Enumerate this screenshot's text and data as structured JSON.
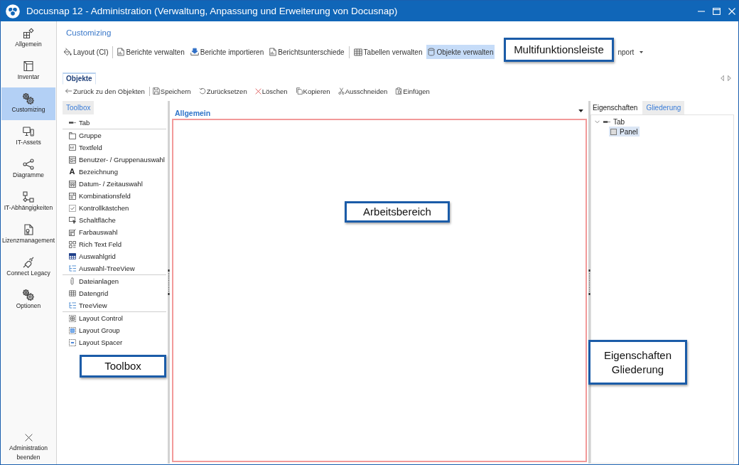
{
  "window": {
    "title": "Docusnap 12 - Administration (Verwaltung, Anpassung und Erweiterung von Docusnap)"
  },
  "sidebar": {
    "items": [
      {
        "label": "Allgemein",
        "selected": false
      },
      {
        "label": "Inventar",
        "selected": false
      },
      {
        "label": "Customizing",
        "selected": true
      },
      {
        "label": "IT-Assets",
        "selected": false
      },
      {
        "label": "Diagramme",
        "selected": false
      },
      {
        "label": "IT-Abhängigkeiten",
        "selected": false
      },
      {
        "label": "Lizenzmanagement",
        "selected": false
      },
      {
        "label": "Connect Legacy",
        "selected": false
      },
      {
        "label": "Optionen",
        "selected": false
      }
    ],
    "exit_button": {
      "label": "Administration beenden"
    }
  },
  "ribbon": {
    "tabs": [
      {
        "label": "Customizing",
        "selected": true
      }
    ],
    "groups": [
      {
        "buttons": [
          {
            "label": "Layout (CI)",
            "selected": false,
            "dropdown": false
          }
        ]
      },
      {
        "buttons": [
          {
            "label": "Berichte verwalten",
            "selected": false,
            "dropdown": false
          },
          {
            "label": "Berichte importieren",
            "selected": false,
            "dropdown": false
          },
          {
            "label": "Berichtsunterschiede",
            "selected": false,
            "dropdown": false
          }
        ]
      },
      {
        "buttons": [
          {
            "label": "Tabellen verwalten",
            "selected": false,
            "dropdown": false
          },
          {
            "label": "Objekte verwalten",
            "selected": true,
            "dropdown": false
          },
          {
            "label": "nport",
            "selected": false,
            "dropdown": true
          }
        ]
      }
    ]
  },
  "document_tabs": [
    {
      "label": "Objekte",
      "selected": true
    }
  ],
  "toolbar": {
    "groups": [
      {
        "buttons": [
          {
            "label": "Zurück zu den Objekten"
          }
        ]
      },
      {
        "buttons": [
          {
            "label": "Speichern"
          },
          {
            "label": "Zurücksetzen"
          },
          {
            "label": "Löschen"
          },
          {
            "label": "Kopieren"
          },
          {
            "label": "Ausschneiden"
          },
          {
            "label": "Einfügen"
          }
        ]
      }
    ]
  },
  "toolbox": {
    "tabs": [
      {
        "label": "Toolbox",
        "selected": true
      }
    ],
    "groups": [
      {
        "items": [
          {
            "label": "Tab"
          }
        ]
      },
      {
        "items": [
          {
            "label": "Gruppe"
          },
          {
            "label": "Textfeld"
          },
          {
            "label": "Benutzer- / Gruppenauswahl"
          },
          {
            "label": "Bezeichnung",
            "glyph": "A"
          },
          {
            "label": "Datum- / Zeitauswahl"
          },
          {
            "label": "Kombinationsfeld"
          },
          {
            "label": "Kontrollkästchen"
          },
          {
            "label": "Schaltfläche"
          },
          {
            "label": "Farbauswahl"
          },
          {
            "label": "Rich Text Feld"
          },
          {
            "label": "Auswahlgrid"
          },
          {
            "label": "Auswahl-TreeView"
          }
        ]
      },
      {
        "items": [
          {
            "label": "Dateianlagen"
          },
          {
            "label": "Datengrid"
          },
          {
            "label": "TreeView"
          }
        ]
      },
      {
        "items": [
          {
            "label": "Layout Control"
          },
          {
            "label": "Layout Group"
          },
          {
            "label": "Layout Spacer"
          }
        ]
      }
    ]
  },
  "workspace": {
    "title": "Allgemein"
  },
  "side_panel": {
    "tabs": [
      {
        "label": "Eigenschaften",
        "selected": false
      },
      {
        "label": "Gliederung",
        "selected": true
      }
    ],
    "tree": [
      {
        "label": "Tab",
        "expanded": true,
        "selected": false,
        "children": [
          {
            "label": "Panel",
            "selected": true
          }
        ]
      }
    ]
  },
  "callouts": [
    {
      "text": "Multifunktionsleiste"
    },
    {
      "text": "Arbeitsbereich"
    },
    {
      "text": "Toolbox"
    },
    {
      "text": "Eigenschaften Gliederung"
    }
  ]
}
